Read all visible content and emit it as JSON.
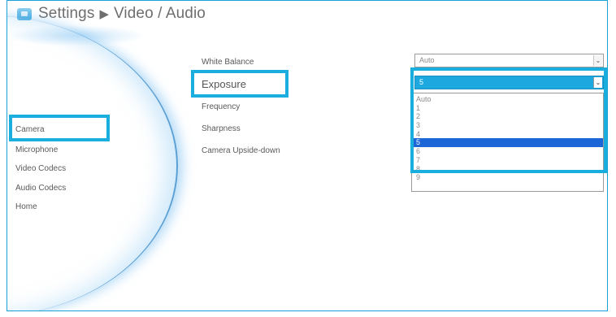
{
  "header": {
    "app": "Settings",
    "separator": "▶",
    "section": "Video / Audio",
    "icon": "monitor-icon"
  },
  "sidebar": {
    "items": [
      {
        "label": "Camera"
      },
      {
        "label": "Microphone"
      },
      {
        "label": "Video Codecs"
      },
      {
        "label": "Audio Codecs"
      },
      {
        "label": "Home"
      }
    ]
  },
  "settings": {
    "white_balance": {
      "label": "White Balance",
      "value": "Auto"
    },
    "exposure": {
      "label": "Exposure",
      "value": "5"
    },
    "frequency": {
      "label": "Frequency"
    },
    "sharpness": {
      "label": "Sharpness"
    },
    "upside_down": {
      "label": "Camera Upside-down"
    }
  },
  "exposure_options": [
    "Auto",
    "1",
    "2",
    "3",
    "4",
    "5",
    "6",
    "7",
    "8",
    "9"
  ],
  "selected_option": "5",
  "colors": {
    "accent": "#19aedd",
    "selected_row": "#1c66d8",
    "active_select": "#1da8e0"
  }
}
